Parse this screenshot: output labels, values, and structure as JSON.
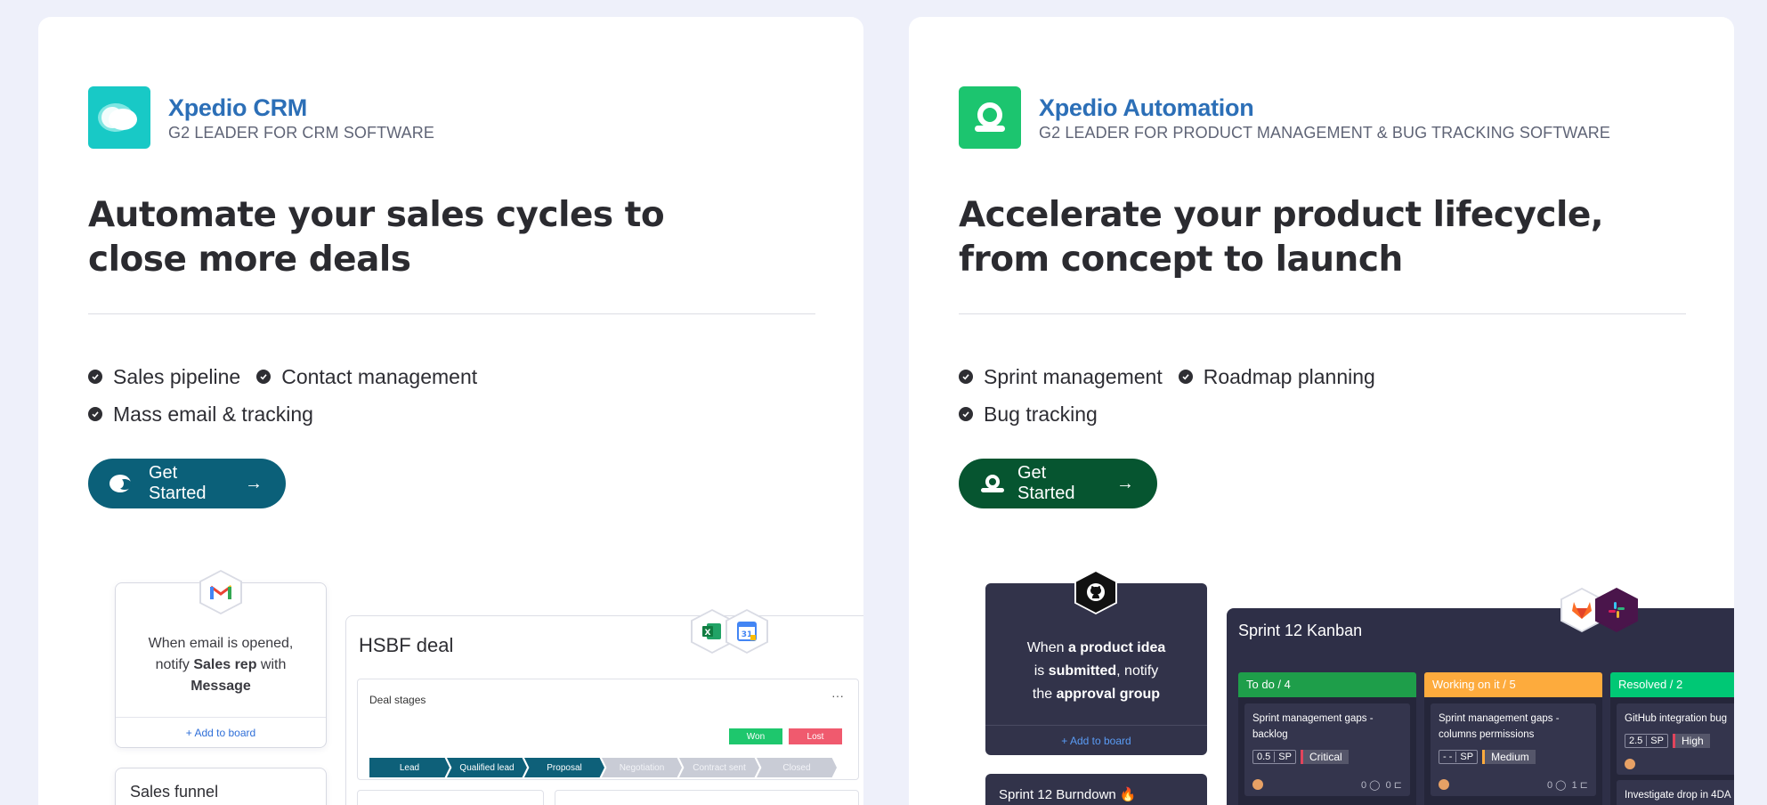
{
  "crm": {
    "brand_name": "Xpedio CRM",
    "brand_sub": "G2 LEADER FOR CRM SOFTWARE",
    "headline": "Automate your sales cycles to close more deals",
    "features": [
      "Sales pipeline",
      "Contact management",
      "Mass email & tracking"
    ],
    "cta_label": "Get Started",
    "accent": "#0b6079",
    "preview": {
      "automation_text_1": "When email is opened,",
      "automation_text_2a": "notify ",
      "automation_text_2b": "Sales rep",
      "automation_text_2c": " with",
      "automation_text_3": "Message",
      "add_board": "+ Add to board",
      "funnel_title": "Sales funnel",
      "deal_title": "HSBF deal",
      "deal_stages_label": "Deal stages",
      "dots": "···",
      "won": "Won",
      "lost": "Lost",
      "stages": [
        "Lead",
        "Qualified lead",
        "Proposal",
        "Negotiation",
        "Contract sent",
        "Closed"
      ]
    }
  },
  "automation": {
    "brand_name": "Xpedio Automation",
    "brand_sub": "G2 LEADER FOR PRODUCT MANAGEMENT & BUG TRACKING SOFTWARE",
    "headline_1": "Accelerate your product lifecycle,",
    "headline_2": "from concept to launch",
    "features": [
      "Sprint management",
      "Roadmap planning",
      "Bug tracking"
    ],
    "cta_label": "Get Started",
    "accent": "#065530",
    "preview": {
      "auto_a": "When ",
      "auto_b": "a product idea",
      "auto_c": "is ",
      "auto_d": "submitted",
      "auto_e": ", notify",
      "auto_f": "the ",
      "auto_g": "approval group",
      "add_board": "+ Add to board",
      "burndown_title": "Sprint 12 Burndown 🔥",
      "kanban_title": "Sprint 12 Kanban",
      "columns": [
        {
          "title": "To do / 4",
          "color": "#1e9e4a",
          "task": "Sprint management gaps - backlog",
          "sp": "0.5",
          "prio": "Critical",
          "prio_color": "#e2445c",
          "comments": "0",
          "subtasks": "0"
        },
        {
          "title": "Working on it / 5",
          "color": "#fdab3d",
          "task": "Sprint management gaps - columns permissions",
          "sp": "- -",
          "prio": "Medium",
          "prio_color": "#fdab3d",
          "comments": "0",
          "subtasks": "1"
        },
        {
          "title": "Resolved / 2",
          "color": "#00c875",
          "task": "GitHub integration bug",
          "sp": "2.5",
          "prio": "High",
          "prio_color": "#e2445c",
          "next_task": "Investigate drop in 4DA"
        }
      ],
      "sp_label": "SP"
    }
  }
}
